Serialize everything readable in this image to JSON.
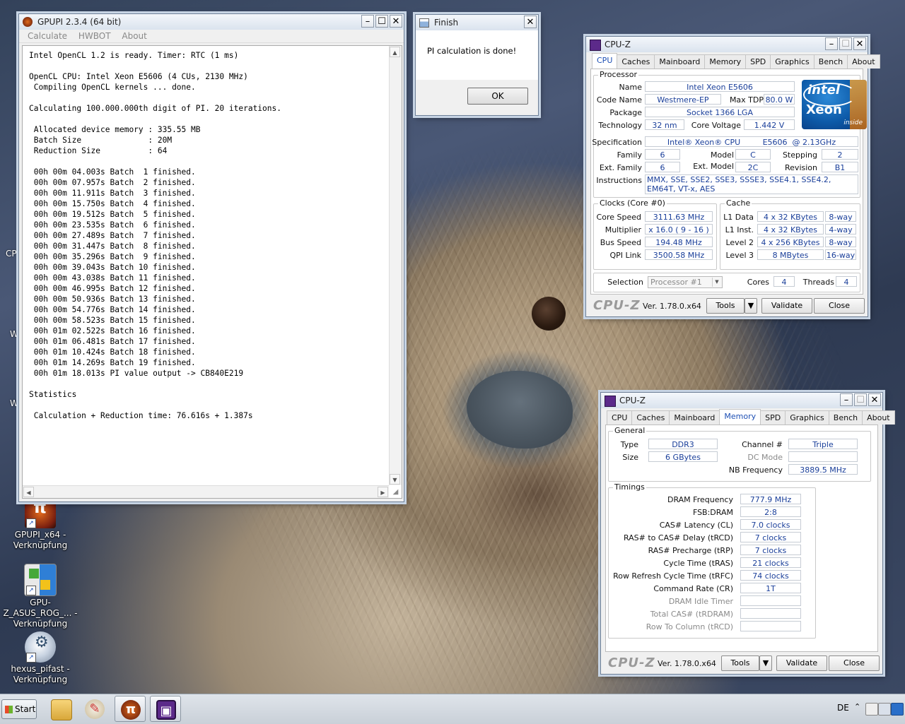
{
  "desktop": {
    "edge_texts": [
      "CP",
      "W",
      "W"
    ],
    "icons": [
      {
        "label": "GPUPI_x64 - Verknüpfung"
      },
      {
        "label": "GPU-Z_ASUS_ROG_... - Verknüpfung"
      },
      {
        "label": "hexus_pifast - Verknüpfung"
      }
    ]
  },
  "gpupi": {
    "title": "GPUPI 2.3.4 (64 bit)",
    "menu": [
      "Calculate",
      "HWBOT",
      "About"
    ],
    "console_text": "Intel OpenCL 1.2 is ready. Timer: RTC (1 ms)\n\nOpenCL CPU: Intel Xeon E5606 (4 CUs, 2130 MHz)\n Compiling OpenCL kernels ... done.\n\nCalculating 100.000.000th digit of PI. 20 iterations.\n\n Allocated device memory : 335.55 MB\n Batch Size              : 20M\n Reduction Size          : 64\n\n 00h 00m 04.003s Batch  1 finished.\n 00h 00m 07.957s Batch  2 finished.\n 00h 00m 11.911s Batch  3 finished.\n 00h 00m 15.750s Batch  4 finished.\n 00h 00m 19.512s Batch  5 finished.\n 00h 00m 23.535s Batch  6 finished.\n 00h 00m 27.489s Batch  7 finished.\n 00h 00m 31.447s Batch  8 finished.\n 00h 00m 35.296s Batch  9 finished.\n 00h 00m 39.043s Batch 10 finished.\n 00h 00m 43.038s Batch 11 finished.\n 00h 00m 46.995s Batch 12 finished.\n 00h 00m 50.936s Batch 13 finished.\n 00h 00m 54.776s Batch 14 finished.\n 00h 00m 58.523s Batch 15 finished.\n 00h 01m 02.522s Batch 16 finished.\n 00h 01m 06.481s Batch 17 finished.\n 00h 01m 10.424s Batch 18 finished.\n 00h 01m 14.269s Batch 19 finished.\n 00h 01m 18.013s PI value output -> CB840E219\n\nStatistics\n\n Calculation + Reduction time: 76.616s + 1.387s"
  },
  "finish": {
    "title": "Finish",
    "message": "PI calculation is done!",
    "ok_label": "OK"
  },
  "cpuz_common": {
    "title": "CPU-Z",
    "tabs": [
      "CPU",
      "Caches",
      "Mainboard",
      "Memory",
      "SPD",
      "Graphics",
      "Bench",
      "About"
    ],
    "logo": "CPU-Z",
    "version": "Ver. 1.78.0.x64",
    "tools_label": "Tools",
    "validate_label": "Validate",
    "close_label": "Close"
  },
  "cpuz_cpu": {
    "active_tab": "CPU",
    "processor": {
      "group_title": "Processor",
      "name_label": "Name",
      "name": "Intel Xeon E5606",
      "codename_label": "Code Name",
      "codename": "Westmere-EP",
      "maxtdp_label": "Max TDP",
      "maxtdp": "80.0 W",
      "package_label": "Package",
      "package": "Socket 1366 LGA",
      "technology_label": "Technology",
      "technology": "32 nm",
      "corevoltage_label": "Core Voltage",
      "corevoltage": "1.442 V",
      "spec_label": "Specification",
      "spec": "Intel® Xeon® CPU         E5606  @ 2.13GHz",
      "family_label": "Family",
      "family": "6",
      "model_label": "Model",
      "model": "C",
      "stepping_label": "Stepping",
      "stepping": "2",
      "extfamily_label": "Ext. Family",
      "extfamily": "6",
      "extmodel_label": "Ext. Model",
      "extmodel": "2C",
      "revision_label": "Revision",
      "revision": "B1",
      "instructions_label": "Instructions",
      "instructions": "MMX, SSE, SSE2, SSE3, SSSE3, SSE4.1, SSE4.2, EM64T, VT-x, AES",
      "logo_brand": "intel",
      "logo_product": "Xeon",
      "logo_inside": "inside"
    },
    "clocks": {
      "group_title": "Clocks (Core #0)",
      "corespeed_label": "Core Speed",
      "corespeed": "3111.63 MHz",
      "multiplier_label": "Multiplier",
      "multiplier": "x 16.0 ( 9 - 16 )",
      "busspeed_label": "Bus Speed",
      "busspeed": "194.48 MHz",
      "qpi_label": "QPI Link",
      "qpi": "3500.58 MHz"
    },
    "cache": {
      "group_title": "Cache",
      "l1d_label": "L1 Data",
      "l1d": "4 x 32 KBytes",
      "l1d_way": "8-way",
      "l1i_label": "L1 Inst.",
      "l1i": "4 x 32 KBytes",
      "l1i_way": "4-way",
      "l2_label": "Level 2",
      "l2": "4 x 256 KBytes",
      "l2_way": "8-way",
      "l3_label": "Level 3",
      "l3": "8 MBytes",
      "l3_way": "16-way"
    },
    "selection": {
      "selection_label": "Selection",
      "selection": "Processor #1",
      "cores_label": "Cores",
      "cores": "4",
      "threads_label": "Threads",
      "threads": "4"
    }
  },
  "cpuz_mem": {
    "active_tab": "Memory",
    "general": {
      "group_title": "General",
      "type_label": "Type",
      "type": "DDR3",
      "size_label": "Size",
      "size": "6 GBytes",
      "channel_label": "Channel #",
      "channel": "Triple",
      "dcmode_label": "DC Mode",
      "dcmode": "",
      "nbfreq_label": "NB Frequency",
      "nbfreq": "3889.5 MHz"
    },
    "timings": {
      "group_title": "Timings",
      "rows": [
        {
          "label": "DRAM Frequency",
          "value": "777.9 MHz",
          "dim": false
        },
        {
          "label": "FSB:DRAM",
          "value": "2:8",
          "dim": false
        },
        {
          "label": "CAS# Latency (CL)",
          "value": "7.0 clocks",
          "dim": false
        },
        {
          "label": "RAS# to CAS# Delay (tRCD)",
          "value": "7 clocks",
          "dim": false
        },
        {
          "label": "RAS# Precharge (tRP)",
          "value": "7 clocks",
          "dim": false
        },
        {
          "label": "Cycle Time (tRAS)",
          "value": "21 clocks",
          "dim": false
        },
        {
          "label": "Row Refresh Cycle Time (tRFC)",
          "value": "74 clocks",
          "dim": false
        },
        {
          "label": "Command Rate (CR)",
          "value": "1T",
          "dim": false
        },
        {
          "label": "DRAM Idle Timer",
          "value": "",
          "dim": true
        },
        {
          "label": "Total CAS# (tRDRAM)",
          "value": "",
          "dim": true
        },
        {
          "label": "Row To Column (tRCD)",
          "value": "",
          "dim": true
        }
      ]
    }
  },
  "taskbar": {
    "start_label": "Start",
    "language": "DE",
    "items": [
      {
        "icon": "explorer-folder-icon",
        "active": false
      },
      {
        "icon": "paint-palette-icon",
        "active": false
      },
      {
        "icon": "gpupi-icon",
        "active": true
      },
      {
        "icon": "cpuz-icon",
        "active": true
      }
    ]
  },
  "colors": {
    "value_text": "#1a3f9a",
    "active_tab_text": "#1d4fb4",
    "title_bar": "#dae3ee"
  }
}
